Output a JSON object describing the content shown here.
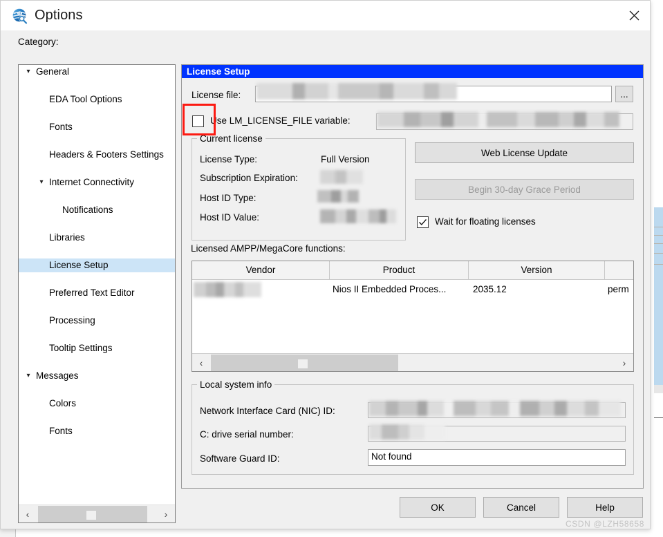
{
  "window": {
    "title": "Options",
    "icon": "quartus-globe-icon",
    "close_label": "✕"
  },
  "category": {
    "label": "Category:",
    "items": [
      {
        "label": "General",
        "indent": 0,
        "caret": "⌄",
        "selected": false
      },
      {
        "label": "EDA Tool Options",
        "indent": 1,
        "caret": "",
        "selected": false
      },
      {
        "label": "Fonts",
        "indent": 1,
        "caret": "",
        "selected": false
      },
      {
        "label": "Headers & Footers Settings",
        "indent": 1,
        "caret": "",
        "selected": false
      },
      {
        "label": "Internet Connectivity",
        "indent": 1,
        "caret": "⌄",
        "selected": false
      },
      {
        "label": "Notifications",
        "indent": 2,
        "caret": "",
        "selected": false
      },
      {
        "label": "Libraries",
        "indent": 1,
        "caret": "",
        "selected": false
      },
      {
        "label": "License Setup",
        "indent": 1,
        "caret": "",
        "selected": true
      },
      {
        "label": "Preferred Text Editor",
        "indent": 1,
        "caret": "",
        "selected": false
      },
      {
        "label": "Processing",
        "indent": 1,
        "caret": "",
        "selected": false
      },
      {
        "label": "Tooltip Settings",
        "indent": 1,
        "caret": "",
        "selected": false
      },
      {
        "label": "Messages",
        "indent": 0,
        "caret": "⌄",
        "selected": false
      },
      {
        "label": "Colors",
        "indent": 1,
        "caret": "",
        "selected": false
      },
      {
        "label": "Fonts",
        "indent": 1,
        "caret": "",
        "selected": false
      }
    ],
    "scroll_left": "‹",
    "scroll_right": "›"
  },
  "panel": {
    "header": "License Setup",
    "license_file_label": "License file:",
    "license_file_value": "",
    "browse_label": "...",
    "use_lm_label": "Use LM_LICENSE_FILE variable:",
    "use_lm_checked": false,
    "use_lm_value": "",
    "current_license": {
      "title": "Current license",
      "rows": [
        {
          "label": "License Type:",
          "value": "Full Version",
          "redacted": false
        },
        {
          "label": "Subscription Expiration:",
          "value": "",
          "redacted": true
        },
        {
          "label": "Host ID Type:",
          "value": "",
          "redacted": true
        },
        {
          "label": "Host ID Value:",
          "value": "",
          "redacted": true
        }
      ]
    },
    "web_update_label": "Web License Update",
    "grace_period_label": "Begin 30-day Grace Period",
    "grace_period_enabled": false,
    "wait_floating_label": "Wait for floating licenses",
    "wait_floating_checked": true,
    "functions_label": "Licensed AMPP/MegaCore functions:",
    "table": {
      "columns": [
        "Vendor",
        "Product",
        "Version",
        ""
      ],
      "rows": [
        {
          "vendor": "",
          "vendor_redacted": true,
          "product": "Nios II Embedded Proces...",
          "version": "2035.12",
          "extra": "perm"
        }
      ],
      "scroll_left": "‹",
      "scroll_right": "›"
    },
    "local_system": {
      "title": "Local system info",
      "rows": [
        {
          "label": "Network Interface Card (NIC) ID:",
          "value": "",
          "redacted": true
        },
        {
          "label": "C: drive serial number:",
          "value": "",
          "redacted": true
        },
        {
          "label": "Software Guard ID:",
          "value": "Not found",
          "redacted": false
        }
      ]
    }
  },
  "footer": {
    "ok": "OK",
    "cancel": "Cancel",
    "help": "Help"
  },
  "annotation": {
    "color": "#fc1a12",
    "target": "use-lm-license-file-checkbox"
  },
  "watermark": "CSDN @LZH58658"
}
